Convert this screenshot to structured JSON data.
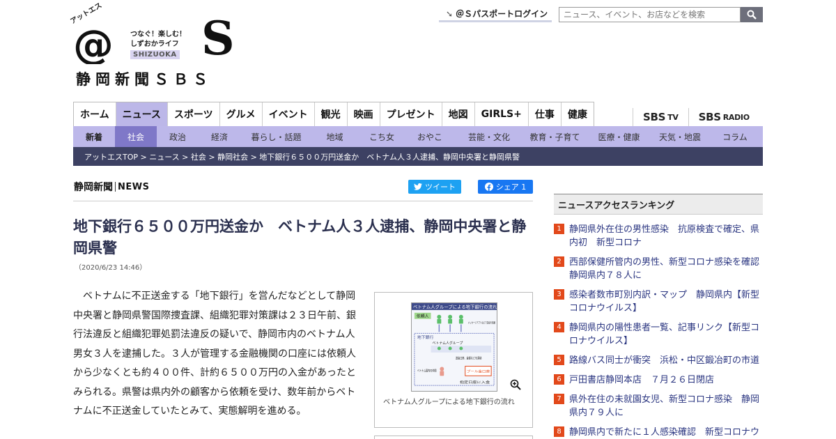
{
  "header": {
    "logo_kana": "アットエス",
    "logo_tagline1": "つなぐ！楽しむ！",
    "logo_tagline2": "しずおかライフ",
    "logo_shizuoka": "SHIZUOKA",
    "logo_brand": "静岡新聞ＳＢＳ",
    "passport_label": "＠Ｓパスポートログイン",
    "search_placeholder": "ニュース、イベント、お店などを検索"
  },
  "main_nav": [
    {
      "label": "ホーム",
      "active": false
    },
    {
      "label": "ニュース",
      "active": true
    },
    {
      "label": "スポーツ",
      "active": false
    },
    {
      "label": "グルメ",
      "active": false
    },
    {
      "label": "イベント",
      "active": false
    },
    {
      "label": "観光",
      "active": false
    },
    {
      "label": "映画",
      "active": false
    },
    {
      "label": "プレゼント",
      "active": false
    },
    {
      "label": "地図",
      "active": false
    },
    {
      "label": "GIRLS+",
      "active": false
    },
    {
      "label": "仕事",
      "active": false
    },
    {
      "label": "健康",
      "active": false
    }
  ],
  "sbs_links": {
    "tv_main": "SBS",
    "tv_sub": "TV",
    "radio_main": "SBS",
    "radio_sub": "RADIO"
  },
  "sub_nav": [
    {
      "label": "新着"
    },
    {
      "label": "社会"
    },
    {
      "label": "政治"
    },
    {
      "label": "経済"
    },
    {
      "label": "暮らし・話題"
    },
    {
      "label": "地域"
    },
    {
      "label": "こち女"
    },
    {
      "label": "おやこ"
    },
    {
      "label": "芸能・文化"
    },
    {
      "label": "教育・子育て"
    },
    {
      "label": "医療・健康"
    },
    {
      "label": "天気・地震"
    },
    {
      "label": "コラム"
    }
  ],
  "breadcrumb": "アットエスTOP > ニュース > 社会 > 静岡社会 > 地下銀行６５００万円送金か　ベトナム人３人逮捕、静岡中央署と静岡県警",
  "article": {
    "source": "静岡新聞",
    "source_news": "NEWS",
    "tweet_label": "ツイート",
    "share_label": "シェア 1",
    "headline": "地下銀行６５００万円送金か　ベトナム人３人逮捕、静岡中央署と静岡県警",
    "date": "（2020/6/23 14:46）",
    "body": "ベトナムに不正送金する「地下銀行」を営んだなどとして静岡中央署と静岡県警国際捜査課、組織犯罪対策課は２３日午前、銀行法違反と組織犯罪処罰法違反の疑いで、静岡市内のベトナム人男女３人を逮捕した。３人が管理する金融機関の口座には依頼人から少なくとも約４００件、計約６５００万円の入金があったとみられる。県警は県内外の顧客から依頼を受け、数年前からベトナムに不正送金していたとみて、実態解明を進める。",
    "figure": {
      "diagram_title": "ベトナム人グループによる地下銀行の流れ",
      "diagram_client": "依頼人",
      "diagram_app": "メッセージアプリなどで送金を依頼",
      "diagram_bank": "地下銀行",
      "diagram_group": "ベトナム人グループ",
      "diagram_send": "送金口座、金額などを連絡",
      "diagram_pool": "プール金口座",
      "diagram_local": "ベトナム国内の仲間",
      "diagram_deposit": "指定口座に入金",
      "caption": "ベトナム人グループによる地下銀行の流れ"
    }
  },
  "ranking": {
    "title": "ニュースアクセスランキング",
    "items": [
      {
        "num": "1",
        "text": "静岡県外在住の男性感染　抗原検査で確定、県内初　新型コロナ"
      },
      {
        "num": "2",
        "text": "西部保健所管内の男性、新型コロナ感染を確認　静岡県内７８人に"
      },
      {
        "num": "3",
        "text": "感染者数市町別内訳・マップ　静岡県内【新型コロナウイルス】"
      },
      {
        "num": "4",
        "text": "静岡県内の陽性患者一覧、記事リンク【新型コロナウイルス】"
      },
      {
        "num": "5",
        "text": "路線バス同士が衝突　浜松・中区鍛冶町の市道"
      },
      {
        "num": "6",
        "text": "戸田書店静岡本店　７月２６日閉店"
      },
      {
        "num": "7",
        "text": "県外在住の未就園女児、新型コロナ感染　静岡県内７９人に"
      },
      {
        "num": "8",
        "text": "静岡県内で新たに１人感染確認　新型コロナウ"
      }
    ]
  },
  "colors": {
    "nav_active": "#bcb7e8",
    "subnav_bg": "#bdb8ea",
    "subnav_active": "#7f78c8",
    "breadcrumb_bg": "#3d4163",
    "rank_badge": "#e2491b",
    "twitter": "#1da1f2",
    "facebook": "#1877f2"
  }
}
